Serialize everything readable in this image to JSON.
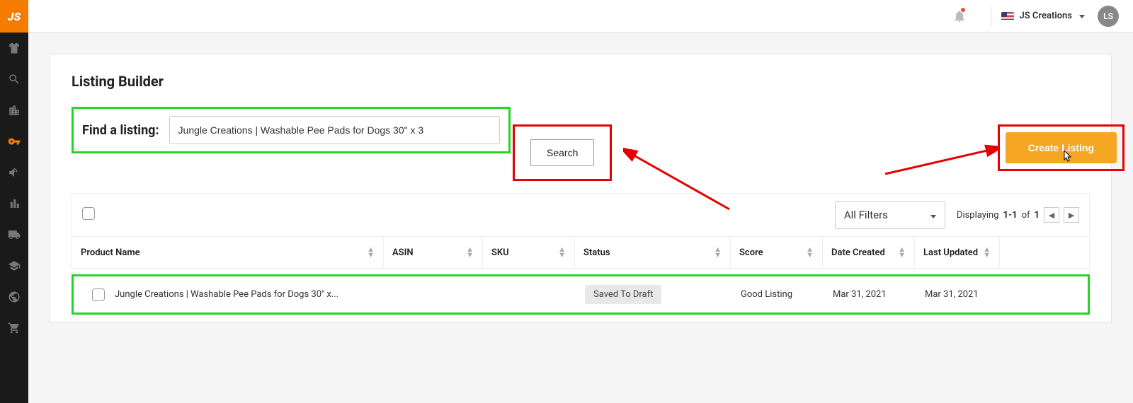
{
  "logo": "JS",
  "account": {
    "name": "JS Creations",
    "initials": "LS"
  },
  "page": {
    "title": "Listing Builder",
    "search_label": "Find a listing:",
    "search_value": "Jungle Creations | Washable Pee Pads for Dogs 30\" x 3",
    "search_button": "Search",
    "create_button": "Create Listing"
  },
  "filters": {
    "dropdown": "All Filters",
    "displaying_label": "Displaying",
    "range": "1-1",
    "of": "of",
    "total": "1"
  },
  "columns": {
    "product_name": "Product Name",
    "asin": "ASIN",
    "sku": "SKU",
    "status": "Status",
    "score": "Score",
    "date_created": "Date Created",
    "last_updated": "Last Updated"
  },
  "rows": [
    {
      "name": "Jungle Creations | Washable Pee Pads for Dogs 30\" x...",
      "asin": "",
      "sku": "",
      "status": "Saved To Draft",
      "score": "Good Listing",
      "date_created": "Mar 31, 2021",
      "last_updated": "Mar 31, 2021"
    }
  ]
}
